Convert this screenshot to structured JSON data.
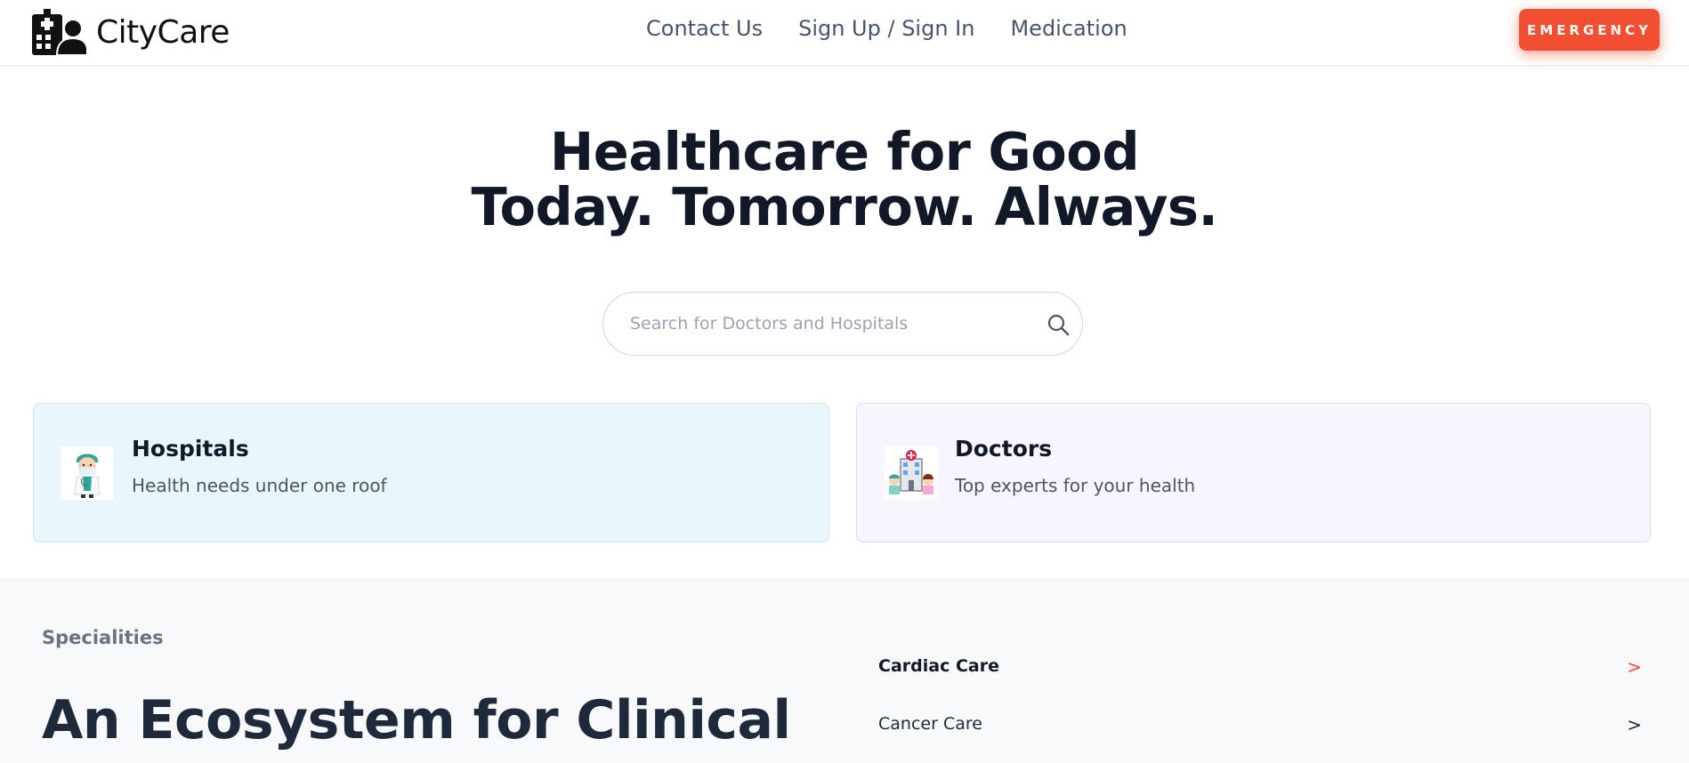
{
  "brand": {
    "name": "CityCare",
    "icon": "hospital-user-icon"
  },
  "nav": {
    "contact": "Contact Us",
    "signup": "Sign Up / Sign In",
    "medication": "Medication"
  },
  "emergency": {
    "label": "EMERGENCY",
    "color": "#f14e32"
  },
  "hero": {
    "line1": "Healthcare for Good",
    "line2": "Today. Tomorrow. Always."
  },
  "search": {
    "placeholder": "Search for Doctors and Hospitals",
    "value": "",
    "icon": "search-icon"
  },
  "cards": [
    {
      "title": "Hospitals",
      "subtitle": "Health needs under one roof",
      "icon": "doctor-illustration",
      "bg": "#e9f7fd"
    },
    {
      "title": "Doctors",
      "subtitle": "Top experts for your health",
      "icon": "hospital-illustration",
      "bg": "#f7f6fe"
    }
  ],
  "specialities": {
    "label": "Specialities",
    "heading": "An Ecosystem for Clinical",
    "items": [
      {
        "name": "Cardiac Care",
        "arrow": ">"
      },
      {
        "name": "Cancer Care",
        "arrow": ">"
      }
    ],
    "accent": "#ef4444"
  }
}
